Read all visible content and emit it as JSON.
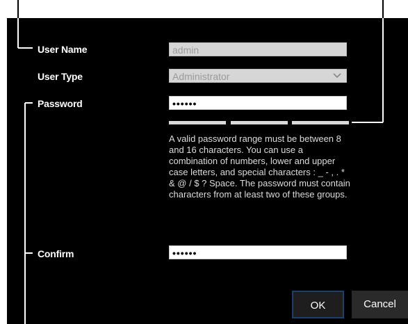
{
  "labels": {
    "user_name": "User Name",
    "user_type": "User Type",
    "password": "Password",
    "confirm": "Confirm"
  },
  "fields": {
    "user_name_value": "admin",
    "user_type_value": "Administrator",
    "password_value": "••••••",
    "confirm_value": "••••••"
  },
  "password_strength": {
    "segments": 3,
    "filled": 0
  },
  "help_text": "A valid password range must be between 8 and 16 characters. You can use a combination of numbers, lower and upper case letters, and special characters : _ - , . * & @ / $ ? Space. The password must contain characters from at least two of these groups.",
  "buttons": {
    "ok": "OK",
    "cancel": "Cancel"
  },
  "colors": {
    "panel_bg": "#000000",
    "ok_border": "#1f3f66"
  }
}
